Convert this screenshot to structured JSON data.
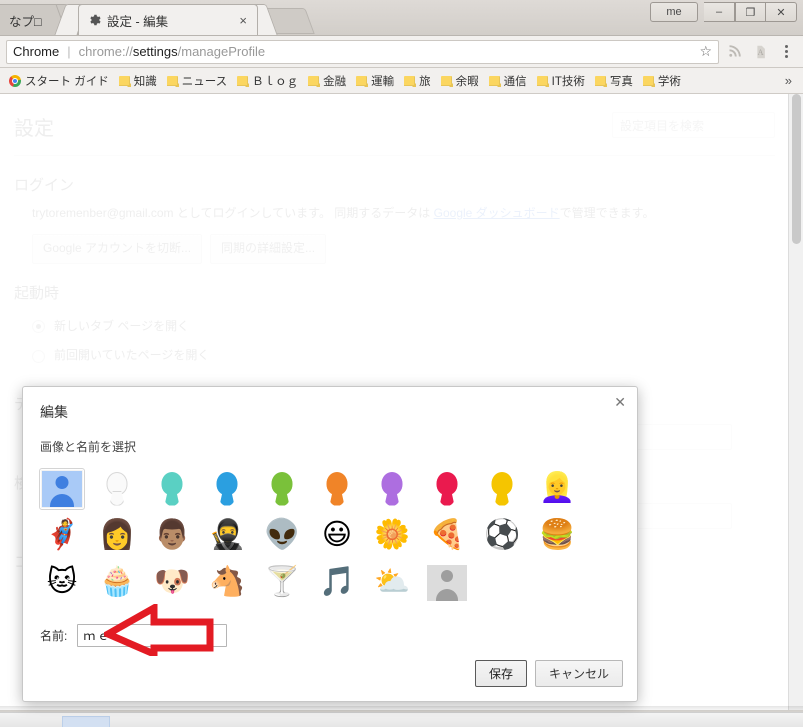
{
  "window": {
    "badge": "me",
    "buttons": [
      "–",
      "❐",
      "✕"
    ]
  },
  "tabs": [
    {
      "label": "なプ□",
      "close": "×",
      "active": false
    },
    {
      "label": "設定 - 編集",
      "close": "×",
      "active": true,
      "icon": "gear-icon"
    }
  ],
  "toolbar": {
    "omnibox": {
      "brand": "Chrome",
      "separator": "|",
      "url_prefix": "chrome://",
      "url_bold": "settings",
      "url_suffix": "/manageProfile",
      "star": "☆"
    },
    "extensions": [
      "rss-icon",
      "pdf-icon"
    ],
    "menu": "chrome-menu-icon"
  },
  "bookmarks": {
    "items": [
      {
        "label": "スタート ガイド",
        "icon": "chrome-icon"
      },
      {
        "label": "知識",
        "icon": "folder-icon"
      },
      {
        "label": "ニュース",
        "icon": "folder-icon"
      },
      {
        "label": "Ｂｌｏｇ",
        "icon": "folder-icon"
      },
      {
        "label": "金融",
        "icon": "folder-icon"
      },
      {
        "label": "運輸",
        "icon": "folder-icon"
      },
      {
        "label": "旅",
        "icon": "folder-icon"
      },
      {
        "label": "余暇",
        "icon": "folder-icon"
      },
      {
        "label": "通信",
        "icon": "folder-icon"
      },
      {
        "label": "IT技術",
        "icon": "folder-icon"
      },
      {
        "label": "写真",
        "icon": "folder-icon"
      },
      {
        "label": "学術",
        "icon": "folder-icon"
      }
    ],
    "overflow": "»"
  },
  "settings": {
    "title": "設定",
    "search_placeholder": "設定項目を検索",
    "signin": {
      "heading": "ログイン",
      "text_before": "trytoremenber@gmail.com としてログインしています。 同期するデータは ",
      "link": "Google ダッシュボード",
      "text_after": "で管理できます。",
      "buttons": [
        "Google アカウントを切断...",
        "同期の詳細設定..."
      ]
    },
    "startup": {
      "heading": "起動時",
      "options": [
        {
          "label": "新しいタブ ページを開く",
          "selected": true
        },
        {
          "label": "前回開いていたページを開く",
          "selected": false
        }
      ]
    },
    "hidden_sections": [
      "デ",
      "検",
      "コ"
    ]
  },
  "modal": {
    "title": "編集",
    "subtitle": "画像と名前を選択",
    "close": "✕",
    "avatars": [
      {
        "name": "avatar-default-blue",
        "type": "default",
        "selected": true
      },
      {
        "name": "avatar-silhouette-white",
        "type": "silhouette",
        "color": "#f7f7f7"
      },
      {
        "name": "avatar-silhouette-teal",
        "type": "silhouette",
        "color": "#5ad0c3"
      },
      {
        "name": "avatar-silhouette-blue",
        "type": "silhouette",
        "color": "#2b9fe0"
      },
      {
        "name": "avatar-silhouette-green",
        "type": "silhouette",
        "color": "#7ac13a"
      },
      {
        "name": "avatar-silhouette-orange",
        "type": "silhouette",
        "color": "#f08428"
      },
      {
        "name": "avatar-silhouette-purple",
        "type": "silhouette",
        "color": "#ad6ee0"
      },
      {
        "name": "avatar-silhouette-red",
        "type": "silhouette",
        "color": "#ea1a4e"
      },
      {
        "name": "avatar-silhouette-yellow",
        "type": "silhouette",
        "color": "#f5c500"
      },
      {
        "name": "avatar-blonde-woman",
        "type": "emoji",
        "glyph": "👱‍♀️"
      },
      {
        "name": "avatar-superhero",
        "type": "emoji",
        "glyph": "🦸"
      },
      {
        "name": "avatar-woman-sunglasses",
        "type": "emoji",
        "glyph": "👩"
      },
      {
        "name": "avatar-man",
        "type": "emoji",
        "glyph": "👨🏽"
      },
      {
        "name": "avatar-ninja",
        "type": "emoji",
        "glyph": "🥷"
      },
      {
        "name": "avatar-alien",
        "type": "emoji",
        "glyph": "👽"
      },
      {
        "name": "avatar-smiley",
        "type": "emoji",
        "glyph": "😃"
      },
      {
        "name": "avatar-daisy",
        "type": "emoji",
        "glyph": "🌼"
      },
      {
        "name": "avatar-pizza",
        "type": "emoji",
        "glyph": "🍕"
      },
      {
        "name": "avatar-soccer-ball",
        "type": "emoji",
        "glyph": "⚽"
      },
      {
        "name": "avatar-hamburger",
        "type": "emoji",
        "glyph": "🍔"
      },
      {
        "name": "avatar-cat",
        "type": "emoji",
        "glyph": "🐱"
      },
      {
        "name": "avatar-cupcake",
        "type": "emoji",
        "glyph": "🧁"
      },
      {
        "name": "avatar-dog",
        "type": "emoji",
        "glyph": "🐶"
      },
      {
        "name": "avatar-horse",
        "type": "emoji",
        "glyph": "🐴"
      },
      {
        "name": "avatar-cocktail",
        "type": "emoji",
        "glyph": "🍸"
      },
      {
        "name": "avatar-music-note",
        "type": "emoji",
        "glyph": "🎵"
      },
      {
        "name": "avatar-sun-behind-cloud",
        "type": "emoji",
        "glyph": "⛅"
      },
      {
        "name": "avatar-generic-grey",
        "type": "grey"
      }
    ],
    "name_label": "名前:",
    "name_value": "ｍｅ",
    "save_label": "保存",
    "cancel_label": "キャンセル"
  },
  "annotation": {
    "arrow_color": "#e31b23",
    "arrow_direction": "left"
  }
}
